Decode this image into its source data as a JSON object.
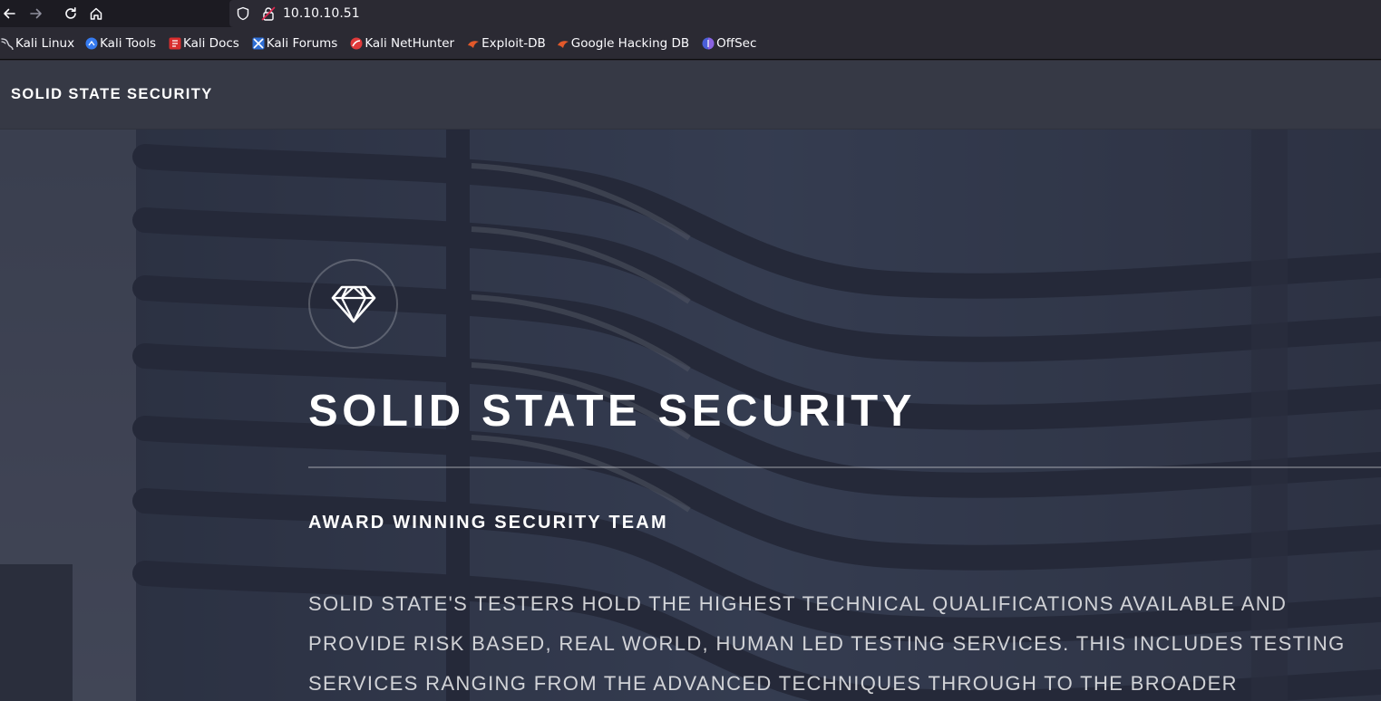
{
  "browser": {
    "url": "10.10.10.51",
    "nav": {
      "back_icon": "arrow-left-icon",
      "forward_icon": "arrow-right-icon",
      "reload_icon": "reload-icon",
      "home_icon": "home-icon"
    },
    "bookmarks": [
      {
        "label": "Kali Linux",
        "icon": "kali-dragon-icon"
      },
      {
        "label": "Kali Tools",
        "icon": "kali-tools-icon"
      },
      {
        "label": "Kali Docs",
        "icon": "kali-docs-icon"
      },
      {
        "label": "Kali Forums",
        "icon": "kali-forums-icon"
      },
      {
        "label": "Kali NetHunter",
        "icon": "nethunter-icon"
      },
      {
        "label": "Exploit-DB",
        "icon": "exploit-db-icon"
      },
      {
        "label": "Google Hacking DB",
        "icon": "ghdb-icon"
      },
      {
        "label": "OffSec",
        "icon": "offsec-icon"
      }
    ]
  },
  "site": {
    "brand": "SOLID STATE SECURITY",
    "hero": {
      "logo_icon": "diamond-icon",
      "title": "SOLID STATE SECURITY",
      "subtitle": "AWARD WINNING SECURITY TEAM",
      "body_lines": [
        "SOLID STATE'S TESTERS HOLD THE HIGHEST TECHNICAL QUALIFICATIONS AVAILABLE AND",
        "PROVIDE RISK BASED, REAL WORLD, HUMAN LED TESTING SERVICES. THIS INCLUDES TESTING",
        "SERVICES RANGING FROM THE ADVANCED TECHNIQUES THROUGH TO THE BROADER"
      ]
    }
  },
  "colors": {
    "toolbar_bg": "#1c1b22",
    "urlbar_bg": "#2b2a33",
    "header_bg": "#363945",
    "hero_overlay": "#2e3141"
  }
}
